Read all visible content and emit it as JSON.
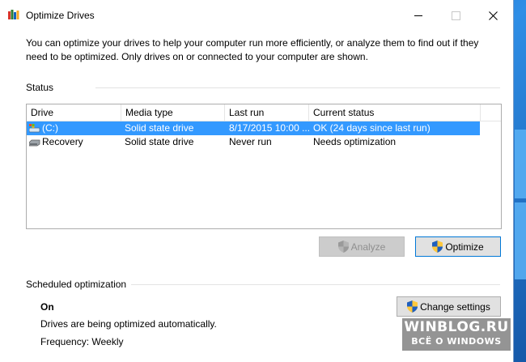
{
  "window": {
    "title": "Optimize Drives"
  },
  "intro_text": "You can optimize your drives to help your computer run more efficiently, or analyze them to find out if they need to be optimized. Only drives on or connected to your computer are shown.",
  "status_section": {
    "label": "Status",
    "columns": [
      "Drive",
      "Media type",
      "Last run",
      "Current status"
    ],
    "rows": [
      {
        "drive": "(C:)",
        "media_type": "Solid state drive",
        "last_run": "8/17/2015 10:00 ...",
        "current_status": "OK (24 days since last run)",
        "selected": true
      },
      {
        "drive": "Recovery",
        "media_type": "Solid state drive",
        "last_run": "Never run",
        "current_status": "Needs optimization",
        "selected": false
      }
    ],
    "analyze_label": "Analyze",
    "optimize_label": "Optimize"
  },
  "scheduled_section": {
    "label": "Scheduled optimization",
    "state": "On",
    "description": "Drives are being optimized automatically.",
    "frequency": "Frequency: Weekly",
    "change_settings_label": "Change settings"
  },
  "watermark": {
    "title": "WINBLOG.RU",
    "subtitle": "ВСЁ О WINDOWS"
  },
  "colors": {
    "selection": "#3399ff",
    "default_button_border": "#0078d7",
    "desktop": "#1662b4"
  }
}
